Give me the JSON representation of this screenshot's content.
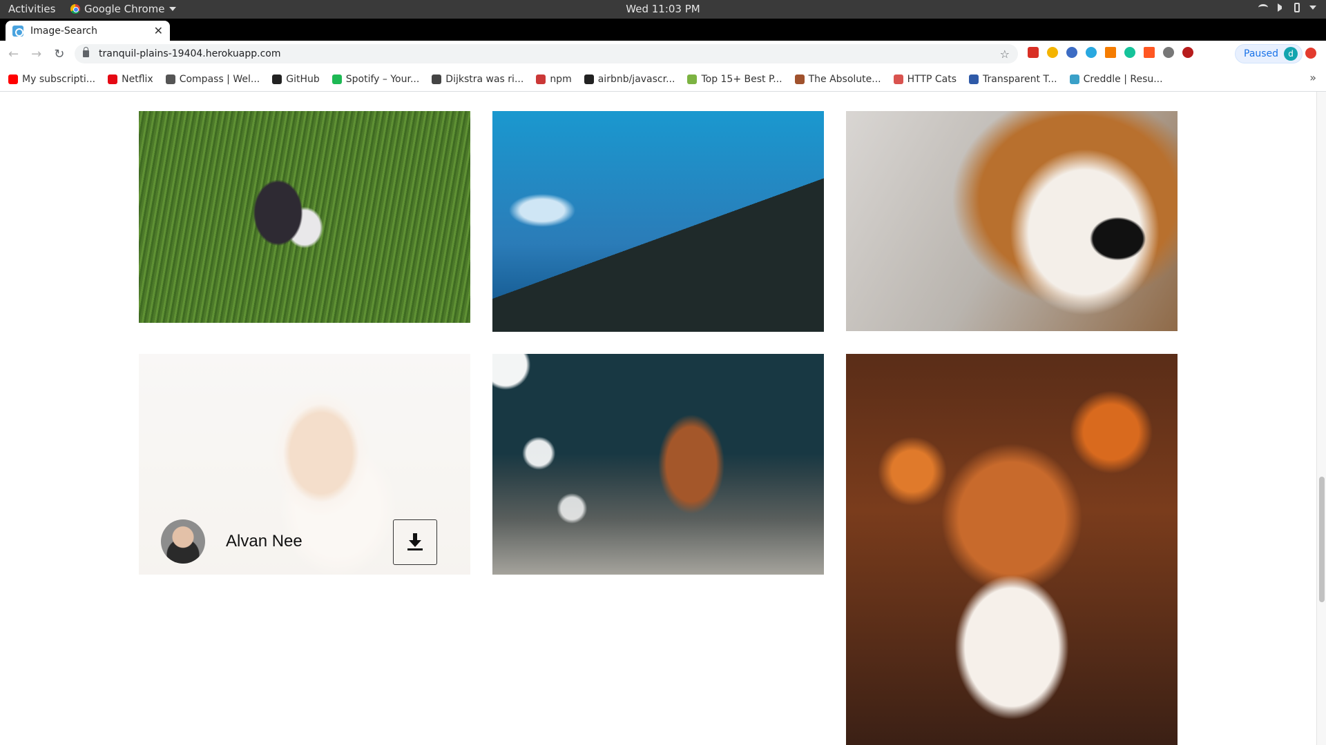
{
  "system_bar": {
    "activities": "Activities",
    "app_name": "Google Chrome",
    "clock": "Wed 11:03 PM"
  },
  "browser": {
    "tab_title": "Image-Search",
    "url": "tranquil-plains-19404.herokuapp.com",
    "profile_status": "Paused",
    "profile_initial": "d",
    "bookmarks": [
      {
        "label": "My subscripti...",
        "color": "#ff0000"
      },
      {
        "label": "Netflix",
        "color": "#e50914"
      },
      {
        "label": "Compass | Wel...",
        "color": "#555555"
      },
      {
        "label": "GitHub",
        "color": "#222222"
      },
      {
        "label": "Spotify – Your...",
        "color": "#1db954"
      },
      {
        "label": "Dijkstra was ri...",
        "color": "#444444"
      },
      {
        "label": "npm",
        "color": "#cb3837"
      },
      {
        "label": "airbnb/javascr...",
        "color": "#222222"
      },
      {
        "label": "Top 15+ Best P...",
        "color": "#7cb342"
      },
      {
        "label": "The Absolute...",
        "color": "#a0522d"
      },
      {
        "label": "HTTP Cats",
        "color": "#d9534f"
      },
      {
        "label": "Transparent T...",
        "color": "#2f5aa8"
      },
      {
        "label": "Creddle | Resu...",
        "color": "#3aa0c8"
      }
    ]
  },
  "gallery": {
    "hover_card": {
      "author_name": "Alvan Nee"
    }
  }
}
